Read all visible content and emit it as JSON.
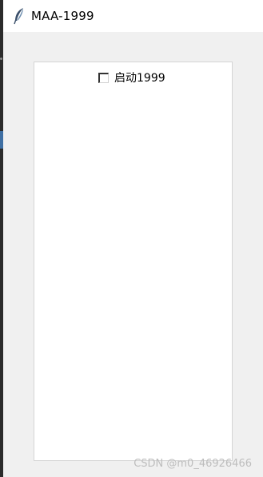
{
  "window": {
    "title": "MAA-1999",
    "icon": "feather-icon"
  },
  "panel": {
    "checkbox": {
      "label": "启动1999",
      "checked": false
    }
  },
  "watermark": {
    "text": "CSDN @m0_46926466"
  },
  "colors": {
    "window_background": "#f0f0f0",
    "titlebar_background": "#ffffff",
    "panel_background": "#ffffff",
    "panel_border": "#d5d5d5",
    "watermark": "#bdbdbd"
  }
}
